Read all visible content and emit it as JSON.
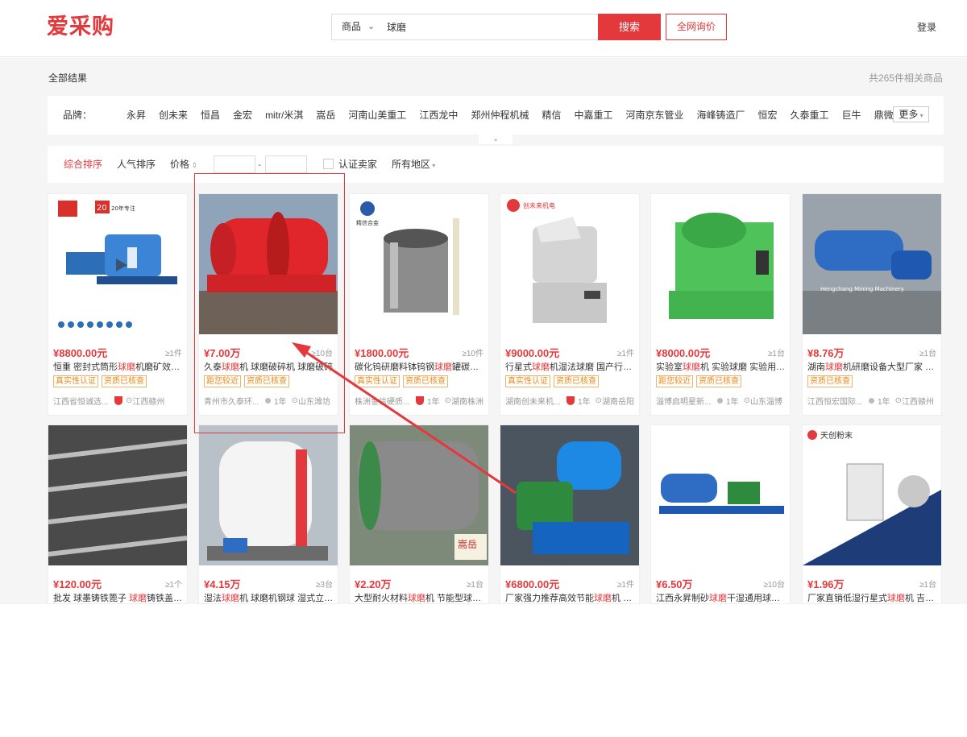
{
  "header": {
    "logo": "爱采购",
    "category": "商品",
    "search_value": "球磨",
    "search_button": "搜索",
    "inquiry_button": "全网询价",
    "login": "登录"
  },
  "results": {
    "breadcrumb": "全部结果",
    "total": "共265件相关商品"
  },
  "brands": {
    "label": "品牌：",
    "items": [
      "永昇",
      "创未来",
      "恒昌",
      "金宏",
      "mitr/米淇",
      "嵩岳",
      "河南山美重工",
      "江西龙中",
      "郑州仲程机械",
      "精信",
      "中嘉重工",
      "河南京东管业",
      "海峰铸造厂",
      "恒宏",
      "久泰重工",
      "巨牛",
      "鼎微"
    ],
    "more": "更多"
  },
  "sort": {
    "items": [
      "综合排序",
      "人气排序",
      "价格"
    ],
    "dash": "-",
    "verified": "认证卖家",
    "region": "所有地区"
  },
  "products": [
    {
      "price": "¥8800.00元",
      "moq": "≥1件",
      "title_pre": "恒重 密封式筒形",
      "kw": "球磨",
      "title_post": "机磨矿效率设...",
      "tags": [
        "真实性认证",
        "资质已核查"
      ],
      "company": "江西省恒诚选...",
      "years": "",
      "location": "江西赣州",
      "shield": true
    },
    {
      "price": "¥7.00万",
      "moq": "≥10台",
      "title_pre": "久泰",
      "kw": "球磨",
      "title_post": "机 球磨破碎机 球磨破碎",
      "tags": [
        "距您较近",
        "资质已核查"
      ],
      "company": "青州市久泰环...",
      "years": "1年",
      "location": "山东潍坊",
      "shield": false
    },
    {
      "price": "¥1800.00元",
      "moq": "≥10件",
      "title_pre": "碳化钨研磨料钵钨钢",
      "kw": "球磨",
      "title_post": "罐碳化钨...",
      "tags": [
        "真实性认证",
        "资质已核查"
      ],
      "company": "株洲金信硬质...",
      "years": "1年",
      "location": "湖南株洲",
      "shield": true
    },
    {
      "price": "¥9000.00元",
      "moq": "≥1件",
      "title_pre": "行星式",
      "kw": "球磨",
      "title_post": "机湿法球磨 国产行星式...",
      "tags": [
        "真实性认证",
        "资质已核查"
      ],
      "company": "湖南创未来机...",
      "years": "1年",
      "location": "湖南岳阳",
      "shield": true
    },
    {
      "price": "¥8000.00元",
      "moq": "≥1台",
      "title_pre": "实验室",
      "kw": "球磨",
      "title_post": "机 实验球磨 实验用球...",
      "tags": [
        "距您较近",
        "资质已核查"
      ],
      "company": "淄博启明星新...",
      "years": "1年",
      "location": "山东淄博",
      "shield": false
    },
    {
      "price": "¥8.76万",
      "moq": "≥1台",
      "title_pre": "湖南",
      "kw": "球磨",
      "title_post": "机研磨设备大型厂家 球磨...",
      "tags": [
        "资质已核查"
      ],
      "company": "江西恒宏国际...",
      "years": "1年",
      "location": "江西赣州",
      "shield": false
    },
    {
      "price": "¥120.00元",
      "moq": "≥1个",
      "title_pre": "批发 球墨铸铁篦子 ",
      "kw": "球磨",
      "title_post": "铸铁盖板...",
      "tags": [],
      "company": "",
      "years": "",
      "location": "",
      "shield": false
    },
    {
      "price": "¥4.15万",
      "moq": "≥3台",
      "title_pre": "湿法",
      "kw": "球磨",
      "title_post": "机 球磨机钢球 湿式立式...",
      "tags": [],
      "company": "",
      "years": "",
      "location": "",
      "shield": false
    },
    {
      "price": "¥2.20万",
      "moq": "≥1台",
      "title_pre": "大型耐火材料",
      "kw": "球磨",
      "title_post": "机 节能型球磨机...",
      "tags": [],
      "company": "",
      "years": "",
      "location": "",
      "shield": false
    },
    {
      "price": "¥6800.00元",
      "moq": "≥1件",
      "title_pre": "厂家强力推荐高效节能",
      "kw": "球磨",
      "title_post": "机 不锈...",
      "tags": [],
      "company": "",
      "years": "",
      "location": "",
      "shield": false
    },
    {
      "price": "¥6.50万",
      "moq": "≥10台",
      "title_pre": "江西永昇制砂",
      "kw": "球磨",
      "title_post": "干湿通用球磨煤...",
      "tags": [],
      "company": "",
      "years": "",
      "location": "",
      "shield": false
    },
    {
      "price": "¥1.96万",
      "moq": "≥1台",
      "title_pre": "厂家直销低湿行星式",
      "kw": "球磨",
      "title_post": "机 吉林行...",
      "tags": [],
      "company": "",
      "years": "",
      "location": "",
      "shield": false
    }
  ],
  "image_labels": {
    "p1_badge": "20年专注",
    "p3_logo": "精信合金",
    "p4_logo": "创未来机电",
    "p6_logo": "Hengchang Mining Machinery",
    "p9_logo": "嵩岳",
    "p12_logo": "天创粉末"
  },
  "colors": {
    "accent": "#e4393c",
    "tag": "#e88a1a"
  }
}
